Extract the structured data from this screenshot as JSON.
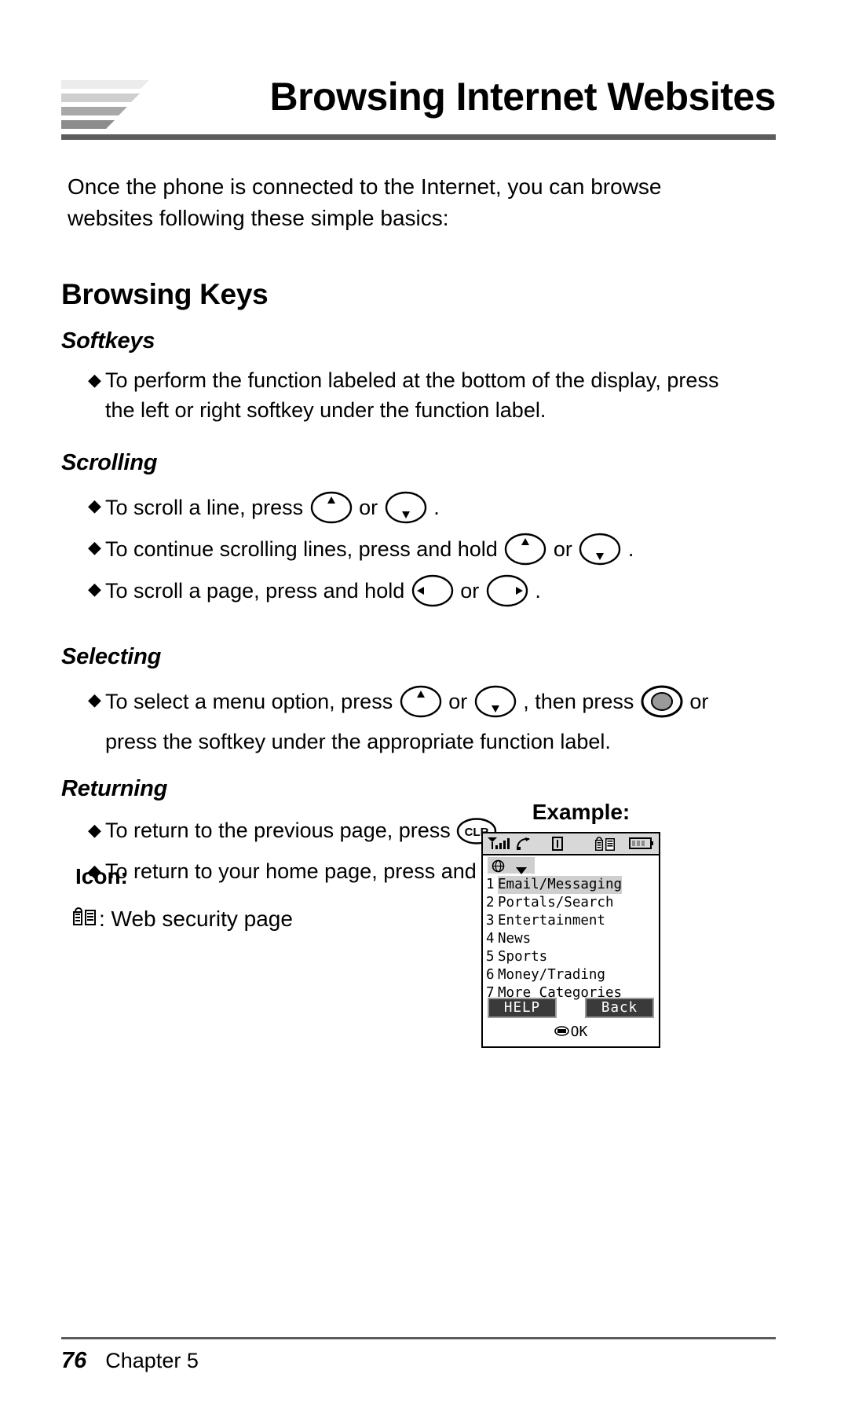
{
  "header": {
    "title": "Browsing Internet Websites",
    "logo_icon": "chevron-stack-logo"
  },
  "intro": {
    "line1": "Once the phone is connected to the Internet, you can browse",
    "line2": "websites following these simple basics:"
  },
  "sections": {
    "browsing_keys_heading": "Browsing Keys",
    "softkeys": {
      "heading": "Softkeys",
      "bullet1_line1": "To perform the function labeled at the bottom of the display, press",
      "bullet1_line2": "the left or right softkey under the function label."
    },
    "scrolling": {
      "heading": "Scrolling",
      "b1_pre": "To scroll a line, press",
      "b1_mid": "or",
      "b1_post": ".",
      "b2_pre": "To continue scrolling lines, press and hold",
      "b2_mid": "or",
      "b2_post": ".",
      "b3_pre": "To scroll a page, press and hold",
      "b3_mid": "or",
      "b3_post": "."
    },
    "selecting": {
      "heading": "Selecting",
      "b1_pre": "To select a menu option, press",
      "b1_mid": "or",
      "b1_mid2": ", then press",
      "b1_post": "or",
      "b1_line2": "press the softkey under the appropriate function label."
    },
    "returning": {
      "heading": "Returning",
      "b1_pre": "To return to the previous page, press",
      "b1_post": ".",
      "b2_pre": "To return to your home page, press and hold",
      "b2_post": "."
    }
  },
  "keys": {
    "up_key": "scroll-up-key",
    "down_key": "scroll-down-key",
    "left_key": "scroll-left-key",
    "right_key": "scroll-right-key",
    "ok_key": "ok-select-key",
    "clr_label": "CLR"
  },
  "example": {
    "label": "Example:",
    "status_icons": [
      "signal-strength-icon",
      "roaming-icon",
      "voice-privacy-icon",
      "web-security-icon",
      "battery-icon"
    ],
    "toolbar": {
      "globe_icon": "globe-icon",
      "dropdown_icon": "chevron-down-icon"
    },
    "menu": [
      {
        "num": "1",
        "label": "Email/Messaging",
        "selected": true
      },
      {
        "num": "2",
        "label": "Portals/Search",
        "selected": false
      },
      {
        "num": "3",
        "label": "Entertainment",
        "selected": false
      },
      {
        "num": "4",
        "label": "News",
        "selected": false
      },
      {
        "num": "5",
        "label": "Sports",
        "selected": false
      },
      {
        "num": "6",
        "label": "Money/Trading",
        "selected": false
      },
      {
        "num": "7",
        "label": "More Categories",
        "selected": false
      }
    ],
    "softkey_left": "HELP",
    "softkey_right": "Back",
    "ok_text": "OK"
  },
  "icon_legend": {
    "heading": "Icon:",
    "icon": "web-security-icon",
    "text": ": Web security page"
  },
  "footer": {
    "page_number": "76",
    "chapter": "Chapter 5"
  },
  "colors": {
    "rule": "#5c5c5c",
    "screen_gray": "#d8d8d8",
    "highlight_gray": "#cfcfcf",
    "softkey_dark": "#3a3a3a"
  }
}
